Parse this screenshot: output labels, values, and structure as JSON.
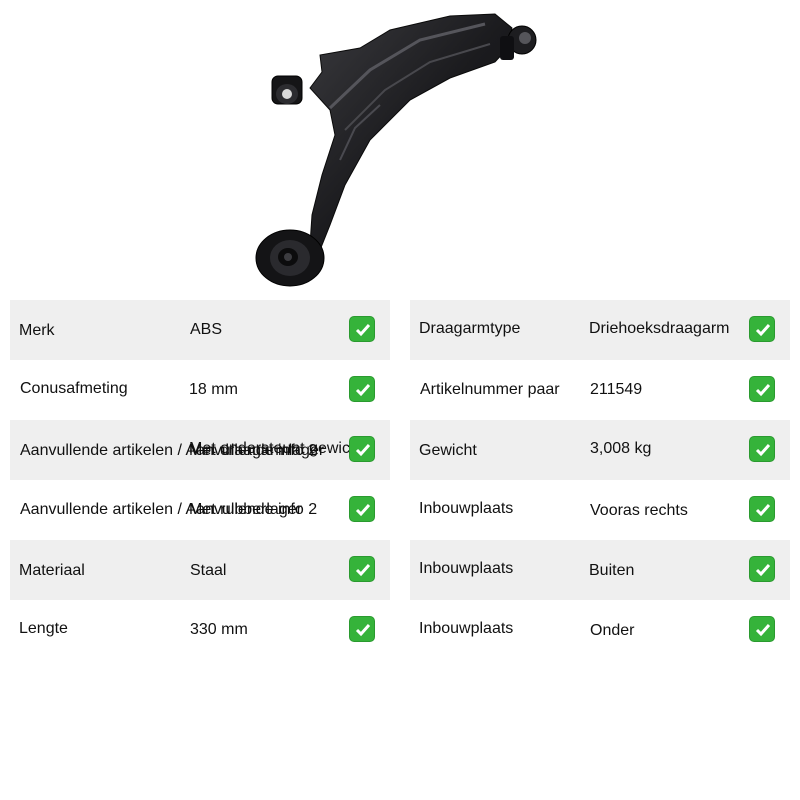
{
  "product": {
    "image_icon": "control-arm-photo"
  },
  "left_table": [
    {
      "label": "Merk",
      "value": "ABS",
      "status": "check-icon"
    },
    {
      "label": "Conusafmeting",
      "value": "18 mm",
      "status": "check-icon"
    },
    {
      "label": "Aanvullende artikelen / Aanvullende info 2",
      "value": "Met draagarmlager",
      "overlay": "Met ondersteunt gewicht",
      "status": "check-icon"
    },
    {
      "label": "Aanvullende artikelen / Aanvullende info 2",
      "value": "Met rubberlager",
      "status": "check-icon"
    },
    {
      "label": "Materiaal",
      "value": "Staal",
      "status": "check-icon"
    },
    {
      "label": "Lengte",
      "value": "330 mm",
      "status": "check-icon"
    }
  ],
  "right_table": [
    {
      "label": "Draagarmtype",
      "value": "Driehoeksdraagarm",
      "status": "check-icon"
    },
    {
      "label": "Artikelnummer paar",
      "value": "211549",
      "status": "check-icon"
    },
    {
      "label": "Gewicht",
      "value": "3,008 kg",
      "status": "check-icon"
    },
    {
      "label": "Inbouwplaats",
      "value": "Vooras rechts",
      "status": "check-icon"
    },
    {
      "label": "Inbouwplaats",
      "value": "Buiten",
      "status": "check-icon"
    },
    {
      "label": "Inbouwplaats",
      "value": "Onder",
      "status": "check-icon"
    }
  ],
  "colors": {
    "row_shade": "#efefef",
    "check_green": "#35b33a"
  }
}
